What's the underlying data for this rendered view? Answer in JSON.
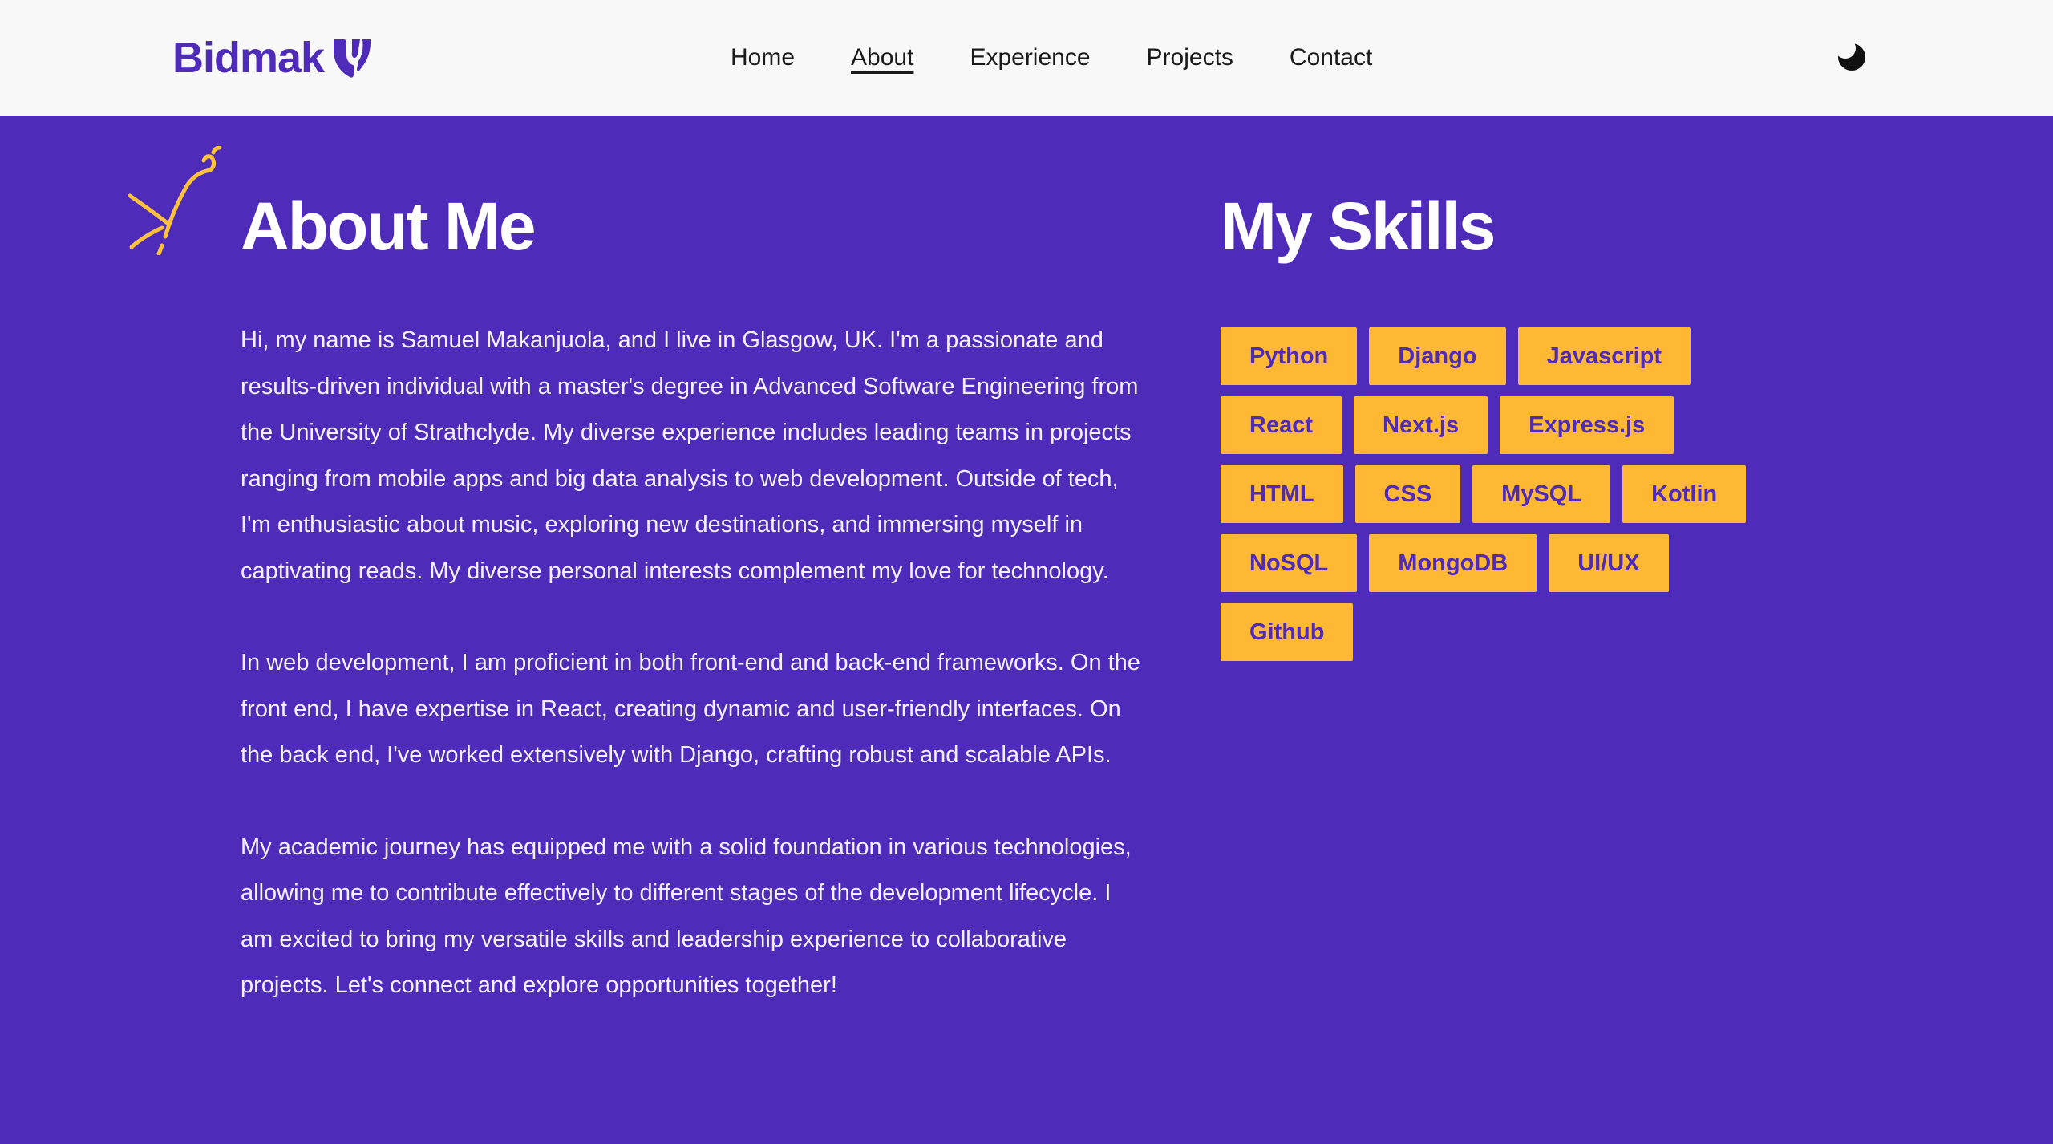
{
  "brand": {
    "name": "Bidmak",
    "logo_icon": "v-shield-logo-icon"
  },
  "nav": {
    "items": [
      {
        "label": "Home"
      },
      {
        "label": "About"
      },
      {
        "label": "Experience"
      },
      {
        "label": "Projects"
      },
      {
        "label": "Contact"
      }
    ],
    "active": "About",
    "theme_toggle_icon": "moon-icon"
  },
  "about": {
    "title": "About Me",
    "decoration_icon": "sparkle-icon",
    "paragraphs": [
      "Hi, my name is Samuel Makanjuola, and I live in Glasgow, UK. I'm a passionate and results-driven individual with a master's degree in Advanced Software Engineering from the University of Strathclyde. My diverse experience includes leading teams in projects ranging from mobile apps and big data analysis to web development. Outside of tech, I'm enthusiastic about music, exploring new destinations, and immersing myself in captivating reads. My diverse personal interests complement my love for technology.",
      "In web development, I am proficient in both front-end and back-end frameworks. On the front end, I have expertise in React, creating dynamic and user-friendly interfaces. On the back end, I've worked extensively with Django, crafting robust and scalable APIs.",
      "My academic journey has equipped me with a solid foundation in various technologies, allowing me to contribute effectively to different stages of the development lifecycle. I am excited to bring my versatile skills and leadership experience to collaborative projects. Let's connect and explore opportunities together!"
    ]
  },
  "skills": {
    "title": "My Skills",
    "items": [
      "Python",
      "Django",
      "Javascript",
      "React",
      "Next.js",
      "Express.js",
      "HTML",
      "CSS",
      "MySQL",
      "Kotlin",
      "NoSQL",
      "MongoDB",
      "UI/UX",
      "Github"
    ]
  },
  "colors": {
    "background": "#4f2bba",
    "navbar": "#f8f8f8",
    "accent": "#ffb833",
    "text_light": "#ffffff"
  }
}
